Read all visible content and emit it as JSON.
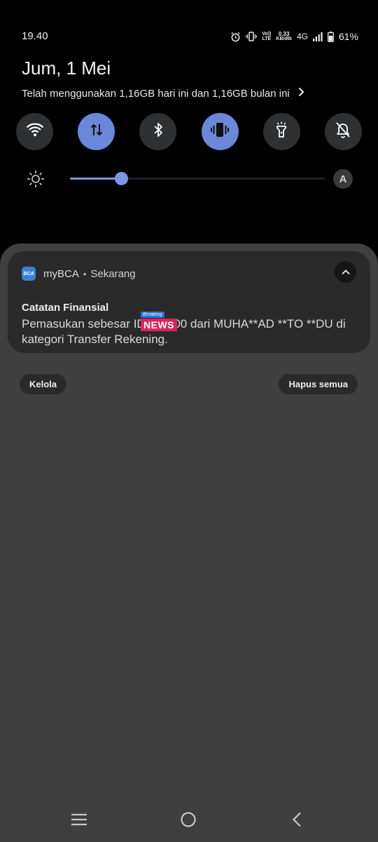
{
  "status_bar": {
    "time": "19.40",
    "volte_top": "Vo))",
    "volte_bottom": "LTE",
    "speed_value": "0.33",
    "speed_unit": "KB/dtk",
    "network": "4G",
    "battery": "61%"
  },
  "header": {
    "date": "Jum, 1 Mei",
    "data_usage": "Telah menggunakan 1,16GB hari ini dan 1,16GB bulan ini"
  },
  "quick_toggles": [
    {
      "icon": "wifi-icon",
      "active": false
    },
    {
      "icon": "mobile-data-icon",
      "active": true
    },
    {
      "icon": "bluetooth-icon",
      "active": false
    },
    {
      "icon": "vibrate-icon",
      "active": true
    },
    {
      "icon": "flashlight-icon",
      "active": false
    },
    {
      "icon": "dnd-off-icon",
      "active": false
    }
  ],
  "brightness": {
    "level": 0.2,
    "auto_label": "A"
  },
  "notification": {
    "app_icon_text": "BCA",
    "app_name": "myBCA",
    "separator": "•",
    "time": "Sekarang",
    "title": "Catatan Finansial",
    "body": "Pemasukan sebesar IDR       00.00 dari MUHA**AD **TO **DU di kategori Transfer Rekening.",
    "overlay_small": "Breaking",
    "overlay_main": "NEWS"
  },
  "actions": {
    "manage": "Kelola",
    "clear_all": "Hapus semua"
  },
  "colors": {
    "toggle_on": "#6a87d9",
    "toggle_off": "#2f3032",
    "panel": "#3f3f3f",
    "card": "#2a2a2a"
  }
}
